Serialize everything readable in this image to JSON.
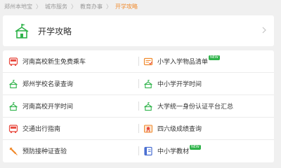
{
  "breadcrumb": {
    "items": [
      "郑州本地宝",
      "城市服务",
      "教育办事"
    ],
    "current": "开学攻略",
    "separator": "〉"
  },
  "header": {
    "title": "开学攻略",
    "icon": "school-icon"
  },
  "rows": [
    {
      "left": {
        "label": "河南高校新生免费乘车",
        "icon": "bus-icon"
      },
      "right": {
        "label": "小学入学物品清单",
        "icon": "checklist-icon",
        "badge": "NEW"
      }
    },
    {
      "left": {
        "label": "郑州学校名录查询",
        "icon": "school-outline-icon"
      },
      "right": {
        "label": "中小学开学时间",
        "icon": "school-outline-icon"
      }
    },
    {
      "left": {
        "label": "河南高校开学时间",
        "icon": "school-outline-icon"
      },
      "right": {
        "label": "大学统一身份认证平台汇总",
        "icon": "school-outline-icon"
      }
    },
    {
      "left": {
        "label": "交通出行指南",
        "icon": "bus-icon"
      },
      "right": {
        "label": "四六级成绩查询",
        "icon": "certificate-icon"
      }
    },
    {
      "left": {
        "label": "预防接种证查验",
        "icon": "syringe-icon"
      },
      "right": {
        "label": "中小学教材",
        "icon": "book-icon",
        "badge": "NEW"
      }
    }
  ],
  "colors": {
    "accent": "#f08a2c",
    "green": "#2fb34a",
    "bus_red": "#e8473c"
  }
}
